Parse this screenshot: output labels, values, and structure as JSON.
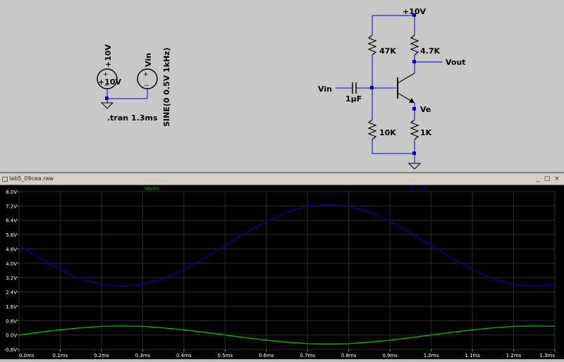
{
  "schematic": {
    "supply_label": "+10V",
    "r1_label": "47K",
    "r2_label": "10K",
    "rc_label": "4.7K",
    "re_label": "1K",
    "cap_label": "1µF",
    "vin_label": "Vin",
    "vout_label": "Vout",
    "ve_label": "Ve",
    "source1_name": "+10V",
    "source1_value": "+10V",
    "source2_name": "Vin",
    "source2_value": "SINE(0 0.5V 1kHz)",
    "directive": ".tran 1.3ms"
  },
  "waveform_window": {
    "title": "lab5_09cea.raw",
    "minimize": "_",
    "maximize": "□",
    "close": "×"
  },
  "colors": {
    "vin_trace": "#00c000",
    "vout_trace": "#0000a0",
    "wire": "#0000cc",
    "component": "#000000",
    "grid_text": "#ffffff"
  },
  "chart_data": {
    "type": "line",
    "x_ticks": [
      "0.0ms",
      "0.1ms",
      "0.2ms",
      "0.3ms",
      "0.4ms",
      "0.5ms",
      "0.6ms",
      "0.7ms",
      "0.8ms",
      "0.9ms",
      "1.0ms",
      "1.1ms",
      "1.2ms",
      "1.3ms"
    ],
    "y_ticks": [
      "-0.8V",
      "0.0V",
      "0.8V",
      "1.6V",
      "2.4V",
      "3.2V",
      "4.0V",
      "4.8V",
      "5.6V",
      "6.4V",
      "7.2V",
      "8.0V"
    ],
    "xlim": [
      0,
      1.3
    ],
    "ylim": [
      -0.8,
      8.0
    ],
    "x": [
      0,
      0.05,
      0.1,
      0.15,
      0.2,
      0.25,
      0.3,
      0.35,
      0.4,
      0.45,
      0.5,
      0.55,
      0.6,
      0.65,
      0.7,
      0.75,
      0.8,
      0.85,
      0.9,
      0.95,
      1.0,
      1.05,
      1.1,
      1.15,
      1.2,
      1.25,
      1.3
    ],
    "series": [
      {
        "name": "V(vin)",
        "color": "#00c000",
        "values": [
          0.0,
          0.15,
          0.29,
          0.4,
          0.48,
          0.5,
          0.48,
          0.4,
          0.29,
          0.15,
          0.0,
          -0.15,
          -0.29,
          -0.4,
          -0.48,
          -0.5,
          -0.48,
          -0.4,
          -0.29,
          -0.15,
          0.0,
          0.15,
          0.29,
          0.4,
          0.48,
          0.5,
          0.48
        ]
      },
      {
        "name": "V(vout)",
        "color": "#0000a0",
        "values": [
          5.0,
          4.29,
          3.66,
          3.14,
          2.82,
          2.72,
          2.82,
          3.14,
          3.66,
          4.29,
          5.0,
          5.71,
          6.34,
          6.86,
          7.18,
          7.28,
          7.18,
          6.86,
          6.34,
          5.71,
          5.0,
          4.29,
          3.66,
          3.14,
          2.82,
          2.72,
          2.82
        ]
      }
    ]
  }
}
